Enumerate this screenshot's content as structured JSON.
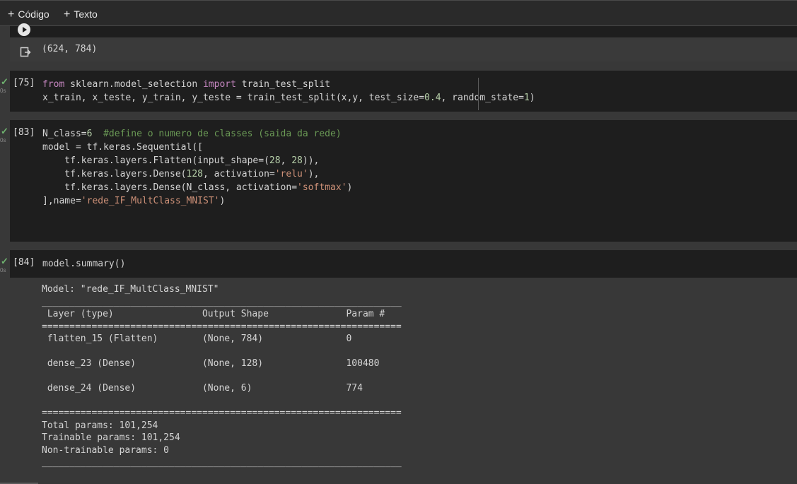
{
  "toolbar": {
    "add_code_label": "Código",
    "add_text_label": "Texto"
  },
  "cells": {
    "prev_output": "(624, 784)",
    "cell75": {
      "exec": "[75]",
      "time": "0s",
      "line1_kw1": "from",
      "line1_mod": " sklearn.model_selection ",
      "line1_kw2": "import",
      "line1_name": " train_test_split",
      "line2_a": "x_train, x_teste, y_train, y_teste = train_test_split(x,y, test_size=",
      "line2_n1": "0.4",
      "line2_b": ", random_state=",
      "line2_n2": "1",
      "line2_c": ")"
    },
    "cell83": {
      "exec": "[83]",
      "time": "0s",
      "l1_a": "N_class=",
      "l1_n": "6",
      "l1_com": "  #define o numero de classes (saida da rede)",
      "l2": "model = tf.keras.Sequential([",
      "l3_a": "    tf.keras.layers.Flatten(input_shape=(",
      "l3_n1": "28",
      "l3_b": ", ",
      "l3_n2": "28",
      "l3_c": ")),",
      "l4_a": "    tf.keras.layers.Dense(",
      "l4_n": "128",
      "l4_b": ", activation=",
      "l4_s": "'relu'",
      "l4_c": "),",
      "l5_a": "    tf.keras.layers.Dense(N_class, activation=",
      "l5_s": "'softmax'",
      "l5_c": ")",
      "l6_a": "],name=",
      "l6_s": "'rede_IF_MultClass_MNIST'",
      "l6_c": ")"
    },
    "cell84": {
      "exec": "[84]",
      "time": "0s",
      "code": "model.summary()"
    }
  },
  "summary": {
    "model_line": "Model: \"rede_IF_MultClass_MNIST\"",
    "rule_top": "_________________________________________________________________",
    "header": " Layer (type)                Output Shape              Param #   ",
    "rule_eq": "=================================================================",
    "rows": [
      " flatten_15 (Flatten)        (None, 784)               0         ",
      " dense_23 (Dense)            (None, 128)               100480    ",
      " dense_24 (Dense)            (None, 6)                 774       "
    ],
    "total": "Total params: 101,254",
    "trainable": "Trainable params: 101,254",
    "non_trainable": "Non-trainable params: 0",
    "rule_bottom": "_________________________________________________________________"
  },
  "colors": {
    "background": "#383838",
    "cell_background": "#1e1e1e",
    "keyword": "#c586c0",
    "string": "#ce9178",
    "number": "#b5cea8",
    "comment": "#6a9955",
    "check": "#6fb36f"
  },
  "icons": {
    "run": "play-circle-icon",
    "output": "output-redirect-icon",
    "check": "checkmark-icon"
  }
}
